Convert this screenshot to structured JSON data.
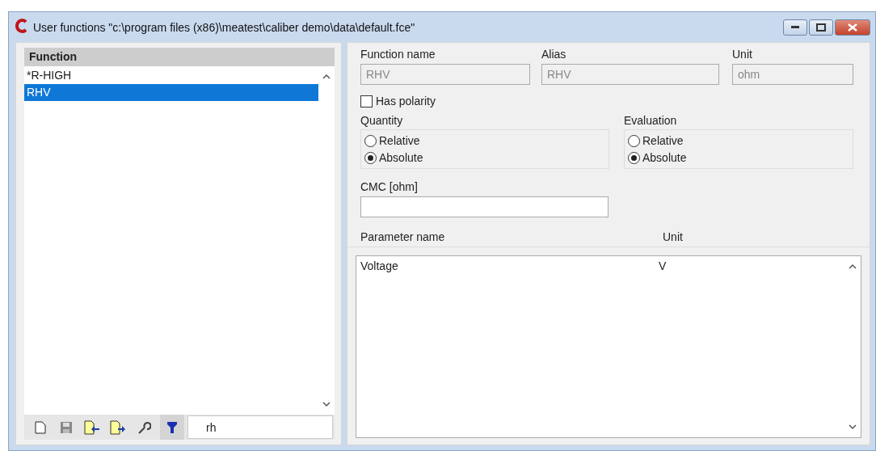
{
  "window": {
    "title": "User functions \"c:\\program files (x86)\\meatest\\caliber demo\\data\\default.fce\""
  },
  "function_list": {
    "header": "Function",
    "items": [
      {
        "name": "*R-HIGH",
        "selected": false
      },
      {
        "name": "RHV",
        "selected": true
      }
    ]
  },
  "toolbar": {
    "filter": "rh"
  },
  "fields": [
    {
      "label": "Function name",
      "value": "RHV",
      "disabled": true
    },
    {
      "label": "Alias",
      "value": "RHV",
      "disabled": true
    },
    {
      "label": "Unit",
      "value": "ohm",
      "disabled": true
    }
  ],
  "has_polarity": {
    "label": "Has polarity",
    "checked": false
  },
  "groups": [
    {
      "label": "Quantity",
      "options": [
        {
          "label": "Relative",
          "selected": false
        },
        {
          "label": "Absolute",
          "selected": true
        }
      ]
    },
    {
      "label": "Evaluation",
      "options": [
        {
          "label": "Relative",
          "selected": false
        },
        {
          "label": "Absolute",
          "selected": true
        }
      ]
    }
  ],
  "cmc": {
    "label": "CMC [ohm]"
  },
  "parameters": {
    "columns": [
      "Parameter name",
      "Unit"
    ],
    "rows": [
      [
        "Voltage",
        "V"
      ]
    ]
  }
}
